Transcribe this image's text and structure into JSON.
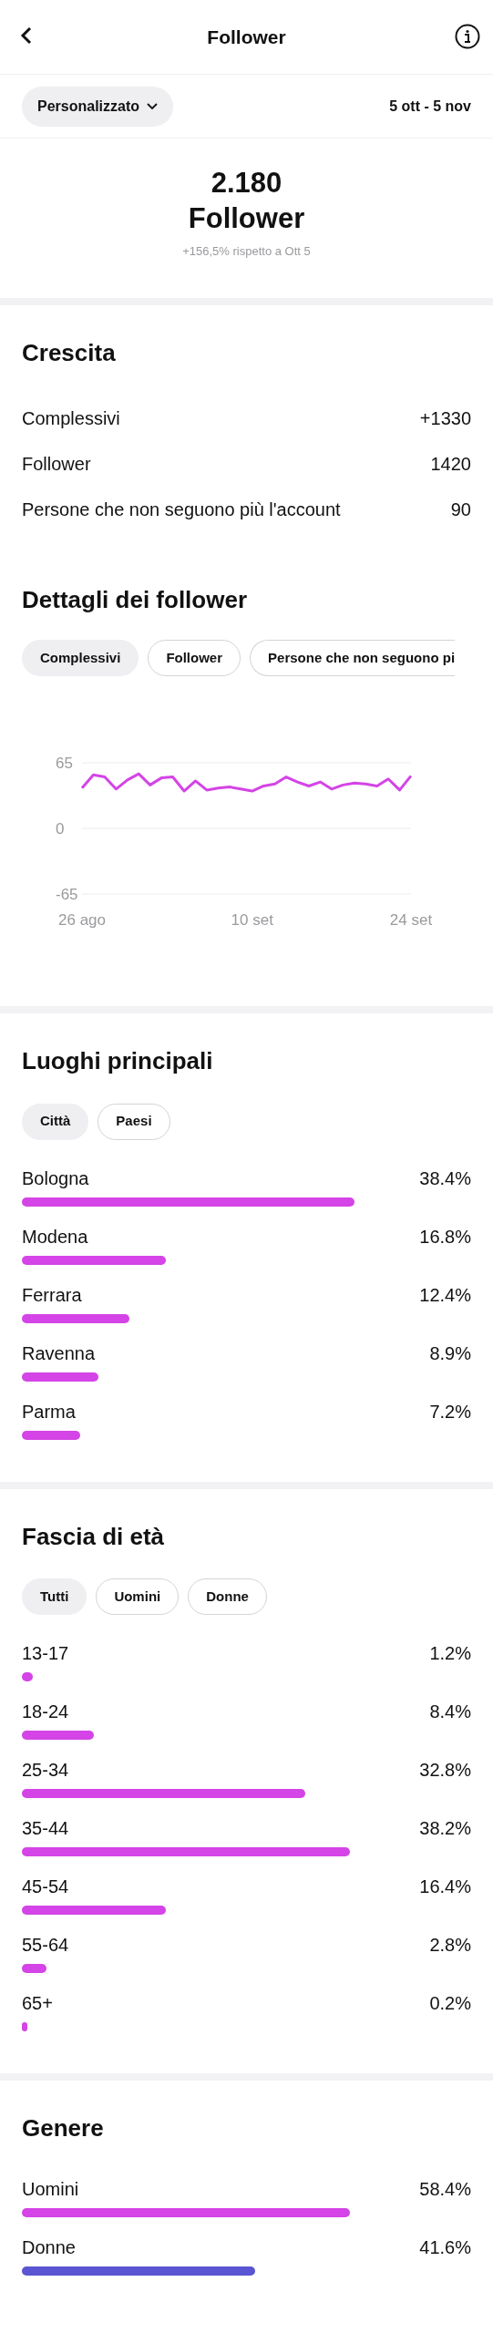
{
  "header": {
    "title": "Follower"
  },
  "filter": {
    "range_button": "Personalizzato",
    "dates": "5 ott - 5 nov"
  },
  "summary": {
    "count": "2.180",
    "label": "Follower",
    "change": "+156,5% rispetto a Ott 5"
  },
  "growth": {
    "title": "Crescita",
    "rows": [
      {
        "label": "Complessivi",
        "value": "+1330"
      },
      {
        "label": "Follower",
        "value": "1420"
      },
      {
        "label": "Persone che non seguono più l'account",
        "value": "90"
      }
    ]
  },
  "details": {
    "title": "Dettagli dei follower",
    "chips": [
      {
        "label": "Complessivi",
        "selected": true
      },
      {
        "label": "Follower",
        "selected": false
      },
      {
        "label": "Persone che non seguono pi",
        "selected": false
      }
    ],
    "chart_data": {
      "type": "line",
      "categories": [
        "26 ago",
        null,
        null,
        null,
        null,
        null,
        null,
        null,
        null,
        null,
        null,
        null,
        null,
        null,
        null,
        "10 set",
        null,
        null,
        null,
        null,
        null,
        null,
        null,
        null,
        null,
        null,
        null,
        null,
        null,
        "24 set"
      ],
      "series": [
        {
          "color": "#d444e6",
          "values": [
            40,
            53,
            51,
            39,
            48,
            54,
            43,
            50,
            51,
            37,
            47,
            38,
            40,
            41,
            39,
            37,
            42,
            44,
            51,
            46,
            42,
            46,
            39,
            43,
            45,
            44,
            42,
            49,
            38,
            52
          ]
        }
      ],
      "ylim": [
        -65,
        65
      ],
      "yticks": [
        -65,
        0,
        65
      ]
    }
  },
  "places": {
    "title": "Luoghi principali",
    "chips": [
      {
        "label": "Città",
        "selected": true
      },
      {
        "label": "Paesi",
        "selected": false
      }
    ],
    "rows": [
      {
        "label": "Bologna",
        "value": "38.4%",
        "level": 0.74
      },
      {
        "label": "Modena",
        "value": "16.8%",
        "level": 0.32
      },
      {
        "label": "Ferrara",
        "value": "12.4%",
        "level": 0.24
      },
      {
        "label": "Ravenna",
        "value": "8.9%",
        "level": 0.17
      },
      {
        "label": "Parma",
        "value": "7.2%",
        "level": 0.13
      }
    ]
  },
  "age": {
    "title": "Fascia di età",
    "chips": [
      {
        "label": "Tutti",
        "selected": true
      },
      {
        "label": "Uomini",
        "selected": false
      },
      {
        "label": "Donne",
        "selected": false
      }
    ],
    "rows": [
      {
        "label": "13-17",
        "value": "1.2%",
        "level": 0.025
      },
      {
        "label": "18-24",
        "value": "8.4%",
        "level": 0.16
      },
      {
        "label": "25-34",
        "value": "32.8%",
        "level": 0.63
      },
      {
        "label": "35-44",
        "value": "38.2%",
        "level": 0.73
      },
      {
        "label": "45-54",
        "value": "16.4%",
        "level": 0.32
      },
      {
        "label": "55-64",
        "value": "2.8%",
        "level": 0.055
      },
      {
        "label": "65+",
        "value": "0.2%",
        "level": 0.012
      }
    ]
  },
  "gender": {
    "title": "Genere",
    "rows": [
      {
        "label": "Uomini",
        "value": "58.4%",
        "level": 0.73,
        "color": "#d444e6"
      },
      {
        "label": "Donne",
        "value": "41.6%",
        "level": 0.52,
        "color": "#5a55d2"
      }
    ]
  }
}
